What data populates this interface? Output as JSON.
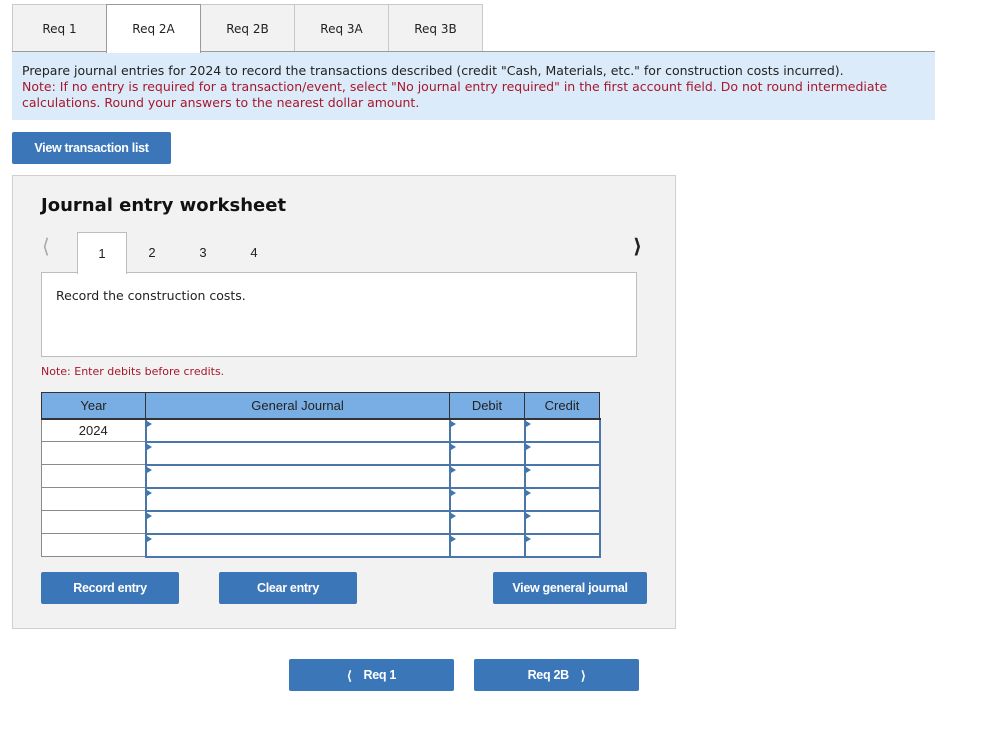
{
  "tabs": [
    {
      "label": "Req 1",
      "active": false
    },
    {
      "label": "Req 2A",
      "active": true
    },
    {
      "label": "Req 2B",
      "active": false
    },
    {
      "label": "Req 3A",
      "active": false
    },
    {
      "label": "Req 3B",
      "active": false
    }
  ],
  "instructions": {
    "main": "Prepare journal entries for 2024 to record the transactions described (credit \"Cash, Materials, etc.\" for construction costs incurred).",
    "note": "Note: If no entry is required for a transaction/event, select \"No journal entry required\" in the first account field. Do not round intermediate calculations. Round your answers to the nearest dollar amount."
  },
  "buttons": {
    "view_transaction_list": "View transaction list",
    "record_entry": "Record entry",
    "clear_entry": "Clear entry",
    "view_general_journal": "View general journal",
    "prev_req": "Req 1",
    "next_req": "Req 2B"
  },
  "worksheet": {
    "title": "Journal entry worksheet",
    "entry_tabs": [
      "1",
      "2",
      "3",
      "4"
    ],
    "active_entry": "1",
    "description": "Record the construction costs.",
    "note": "Note: Enter debits before credits."
  },
  "journal": {
    "headers": {
      "year": "Year",
      "general_journal": "General Journal",
      "debit": "Debit",
      "credit": "Credit"
    },
    "rows": [
      {
        "year": "2024",
        "account": "",
        "debit": "",
        "credit": ""
      },
      {
        "year": "",
        "account": "",
        "debit": "",
        "credit": ""
      },
      {
        "year": "",
        "account": "",
        "debit": "",
        "credit": ""
      },
      {
        "year": "",
        "account": "",
        "debit": "",
        "credit": ""
      },
      {
        "year": "",
        "account": "",
        "debit": "",
        "credit": ""
      },
      {
        "year": "",
        "account": "",
        "debit": "",
        "credit": ""
      }
    ]
  },
  "icons": {
    "prev": "‹",
    "next": "›",
    "chev_left": "<",
    "chev_right": ">"
  }
}
